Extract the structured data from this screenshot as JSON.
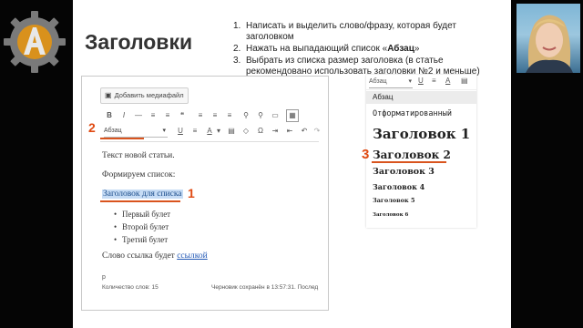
{
  "slide": {
    "title": "Заголовки",
    "steps": [
      {
        "n": "1.",
        "text": "Написать и выделить слово/фразу, которая будет заголовком"
      },
      {
        "n": "2.",
        "text_before": "Нажать на выпадающий список «",
        "bold": "Абзац",
        "text_after": "»"
      },
      {
        "n": "3.",
        "text": "Выбрать из списка размер заголовка (в статье рекомендовано использовать заголовки №2 и меньше)"
      }
    ]
  },
  "editor": {
    "media_button": "Добавить медиафайл",
    "format_select": "Абзац",
    "toolbar_row1": [
      "B",
      "I",
      "—",
      "≡",
      "≡",
      "❝",
      "≡",
      "≡",
      "≡",
      "⚲",
      "⚲",
      "▭",
      "▦"
    ],
    "toolbar_row2": [
      "U",
      "≡",
      "A",
      "▾",
      "▤",
      "◇",
      "Ω",
      "⇥",
      "⇤",
      "↶",
      "↷"
    ],
    "content": {
      "p1": "Текст новой статьи.",
      "p2": "Формируем список:",
      "heading": "Заголовок для списка",
      "bullets": [
        "Первый булет",
        "Второй булет",
        "Третий булет"
      ],
      "p3_text": "Слово ссылка будет ",
      "p3_link": "ссылкой",
      "path": "p"
    },
    "footer": {
      "word_count": "Количество слов: 15",
      "draft": "Черновик сохранён в 13:57:31. Послед"
    }
  },
  "dropdown": {
    "select_value": "Абзац",
    "items": [
      "Абзац",
      "Отформатированный",
      "Заголовок 1",
      "Заголовок 2",
      "Заголовок 3",
      "Заголовок 4",
      "Заголовок 5",
      "Заголовок 6"
    ]
  },
  "annotations": {
    "one": "1",
    "two": "2",
    "three": "3"
  },
  "colors": {
    "accent": "#e04a12",
    "highlight": "#c6dcf5",
    "link": "#1f56b4"
  }
}
